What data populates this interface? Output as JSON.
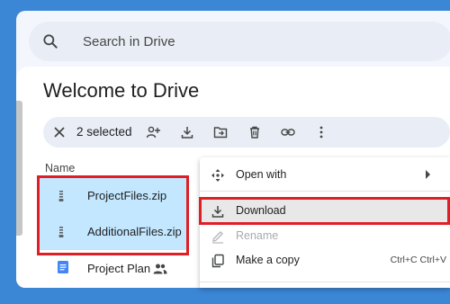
{
  "search": {
    "placeholder": "Search in Drive"
  },
  "page": {
    "title": "Welcome to Drive"
  },
  "selection_bar": {
    "count_label": "2 selected",
    "actions": [
      "close-icon",
      "share-icon",
      "download-icon",
      "move-icon",
      "trash-icon",
      "link-icon",
      "more-vert-icon"
    ]
  },
  "file_list": {
    "column_name": "Name",
    "files": [
      {
        "name": "ProjectFiles.zip",
        "type": "zip",
        "selected": true
      },
      {
        "name": "AdditionalFiles.zip",
        "type": "zip",
        "selected": true
      },
      {
        "name": "Project Plan",
        "type": "doc",
        "selected": false,
        "shared": true
      }
    ]
  },
  "context_menu": {
    "open_with": "Open with",
    "download": "Download",
    "rename": "Rename",
    "make_copy": "Make a copy",
    "make_copy_shortcut": "Ctrl+C Ctrl+V"
  },
  "colors": {
    "background": "#3b87d6",
    "selection": "#c2e7ff",
    "highlight_red": "#e01e26",
    "doc_blue": "#4285f4"
  }
}
